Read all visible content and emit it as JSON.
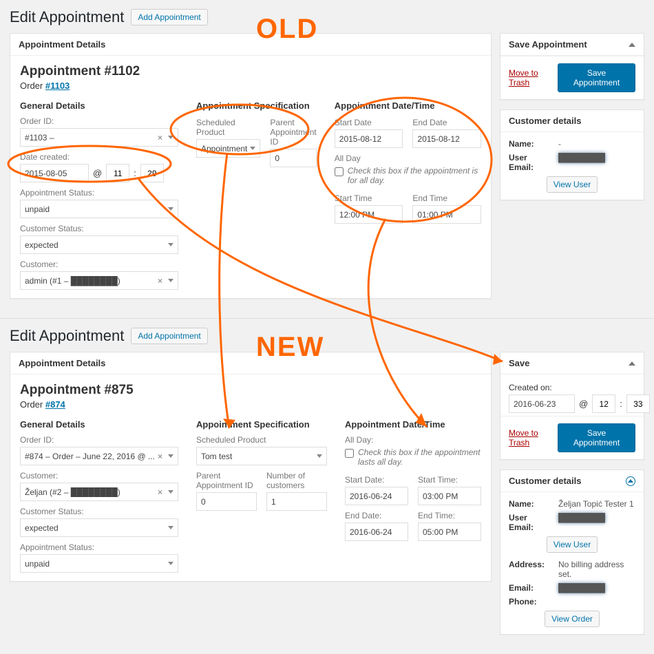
{
  "annotations": {
    "old_label": "OLD",
    "new_label": "NEW"
  },
  "old": {
    "page_title": "Edit Appointment",
    "add_button": "Add Appointment",
    "details_panel_title": "Appointment Details",
    "appointment_title": "Appointment #1102",
    "order_label": "Order",
    "order_link_text": "#1103",
    "general": {
      "heading": "General Details",
      "order_id_label": "Order ID:",
      "order_id_value": "#1103 –",
      "date_created_label": "Date created:",
      "date_created_value": "2015-08-05",
      "at_symbol": "@",
      "hour": "11",
      "minute": "29",
      "status_label": "Appointment Status:",
      "status_value": "unpaid",
      "cust_status_label": "Customer Status:",
      "cust_status_value": "expected",
      "customer_label": "Customer:",
      "customer_value": "admin (#1 – ████████)"
    },
    "spec": {
      "heading": "Appointment Specification",
      "product_label": "Scheduled Product",
      "product_value": "Appointment",
      "parent_label": "Parent Appointment ID",
      "parent_value": "0"
    },
    "datetime": {
      "heading": "Appointment Date/Time",
      "start_date_label": "Start Date",
      "start_date_value": "2015-08-12",
      "end_date_label": "End Date",
      "end_date_value": "2015-08-12",
      "all_day_label": "All Day",
      "all_day_text": "Check this box if the appointment is for all day.",
      "start_time_label": "Start Time",
      "start_time_value": "12:00 PM",
      "end_time_label": "End Time",
      "end_time_value": "01:00 PM"
    },
    "save_panel": {
      "title": "Save Appointment",
      "trash": "Move to Trash",
      "button": "Save Appointment"
    },
    "cust_panel": {
      "title": "Customer details",
      "name_label": "Name:",
      "name_value": "-",
      "email_label": "User Email:",
      "email_value": "████████",
      "view_user": "View User"
    }
  },
  "new": {
    "page_title": "Edit Appointment",
    "add_button": "Add Appointment",
    "details_panel_title": "Appointment Details",
    "appointment_title": "Appointment #875",
    "order_label": "Order",
    "order_link_text": "#874",
    "general": {
      "heading": "General Details",
      "order_id_label": "Order ID:",
      "order_id_value": "#874 – Order – June 22, 2016 @ ...",
      "customer_label": "Customer:",
      "customer_value": "Željan (#2 – ████████)",
      "cust_status_label": "Customer Status:",
      "cust_status_value": "expected",
      "status_label": "Appointment Status:",
      "status_value": "unpaid"
    },
    "spec": {
      "heading": "Appointment Specification",
      "product_label": "Scheduled Product",
      "product_value": "Tom test",
      "parent_label": "Parent Appointment ID",
      "parent_value": "0",
      "numcust_label": "Number of customers",
      "numcust_value": "1"
    },
    "datetime": {
      "heading": "Appointment Date/Time",
      "all_day_label": "All Day:",
      "all_day_text": "Check this box if the appointment lasts all day.",
      "start_date_label": "Start Date:",
      "start_date_value": "2016-06-24",
      "start_time_label": "Start Time:",
      "start_time_value": "03:00 PM",
      "end_date_label": "End Date:",
      "end_date_value": "2016-06-24",
      "end_time_label": "End Time:",
      "end_time_value": "05:00 PM"
    },
    "save_panel": {
      "title": "Save",
      "created_label": "Created on:",
      "created_value": "2016-06-23",
      "at_symbol": "@",
      "hour": "12",
      "minute": "33",
      "trash": "Move to Trash",
      "button": "Save Appointment"
    },
    "cust_panel": {
      "title": "Customer details",
      "name_label": "Name:",
      "name_value": "Željan Topić Tester 1",
      "email_label": "User Email:",
      "email_value": "████████",
      "view_user": "View User",
      "address_label": "Address:",
      "address_value": "No billing address set.",
      "email2_label": "Email:",
      "email2_value": "████████",
      "phone_label": "Phone:",
      "phone_value": "",
      "view_order": "View Order"
    }
  }
}
